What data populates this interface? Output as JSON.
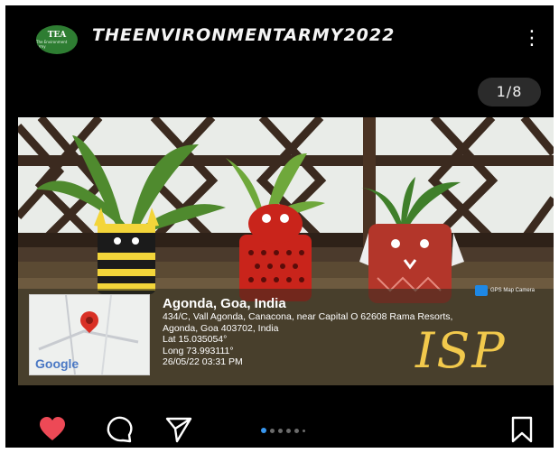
{
  "header": {
    "avatar_letters": "TEA",
    "avatar_tagline": "The Environment Army",
    "username": "THEENVIRONMENTARMY2022",
    "more_icon": "⋮"
  },
  "carousel": {
    "counter": "1/8",
    "total_dots": 6,
    "active_index": 0
  },
  "photo": {
    "stamp": {
      "place": "Agonda, Goa, India",
      "address_line1": "434/C, Vall Agonda, Canacona, near Capital O 62608 Rama Resorts,",
      "address_line2": "Agonda, Goa 403702, India",
      "lat": "Lat 15.035054°",
      "long": "Long 73.993111°",
      "datetime": "26/05/22 03:31 PM",
      "map_label": "Google",
      "badge": "GPS Map Camera"
    },
    "signature": "ISP"
  },
  "colors": {
    "like": "#ed4956",
    "background": "#000000",
    "active_dot": "#3897f0"
  },
  "icons": {
    "like": "heart-icon",
    "comment": "comment-icon",
    "share": "paper-plane-icon",
    "save": "bookmark-icon"
  }
}
